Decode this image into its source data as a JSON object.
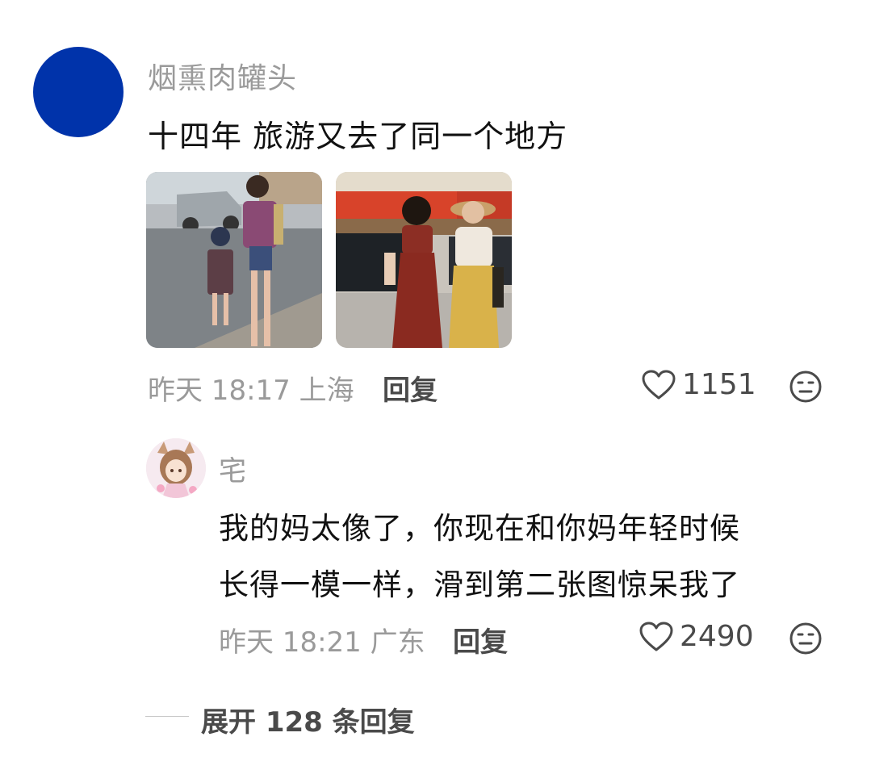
{
  "comment": {
    "username": "烟熏肉罐头",
    "text": "十四年 旅游又去了同一个地方",
    "meta": "昨天 18:17 上海",
    "reply_label": "回复",
    "like_count": "1151",
    "avatar_color": "#0033aa",
    "images": [
      {
        "icon": "photo-mother-child-street"
      },
      {
        "icon": "photo-two-women-street"
      }
    ]
  },
  "reply": {
    "username": "宅",
    "text_line1": "我的妈太像了，你现在和你妈年轻时候",
    "text_line2": "长得一模一样，滑到第二张图惊呆我了",
    "meta": "昨天 18:21 广东",
    "reply_label": "回复",
    "like_count": "2490"
  },
  "expand": {
    "label": "展开 128 条回复"
  },
  "icons": {
    "like": "heart-outline-icon",
    "emoji": "neutral-face-icon"
  }
}
